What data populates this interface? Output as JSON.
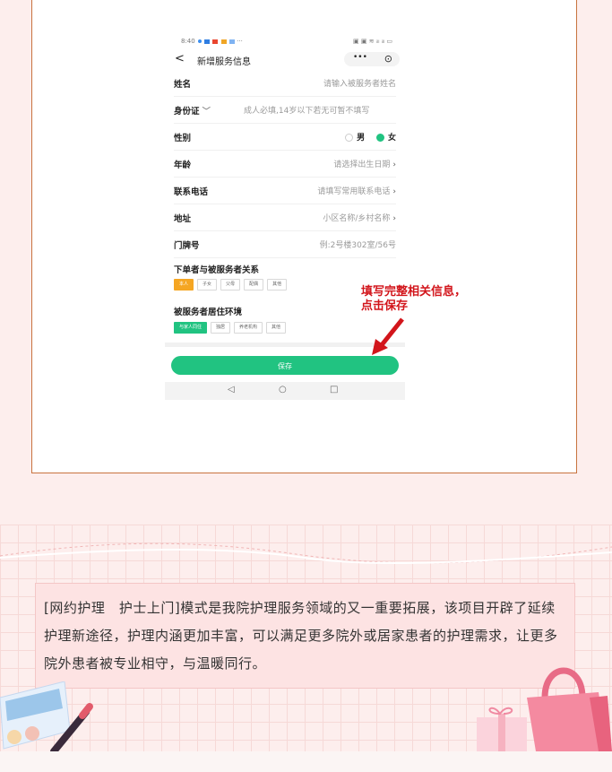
{
  "phone": {
    "status": {
      "time": "8:40",
      "dots": "···"
    },
    "nav": {
      "back": "<",
      "title": "新增服务信息",
      "more": "•••",
      "target": "⊙"
    },
    "form": {
      "name": {
        "label": "姓名",
        "placeholder": "请输入被服务者姓名"
      },
      "id_card": {
        "label": "身份证",
        "placeholder": "成人必填,14岁以下若无可暂不填写"
      },
      "gender": {
        "label": "性别",
        "options": [
          "男",
          "女"
        ],
        "selected": "女"
      },
      "age": {
        "label": "年龄",
        "placeholder": "请选择出生日期"
      },
      "phone": {
        "label": "联系电话",
        "placeholder": "请填写常用联系电话"
      },
      "address": {
        "label": "地址",
        "placeholder": "小区名称/乡村名称"
      },
      "door": {
        "label": "门牌号",
        "placeholder": "例:2号楼302室/56号"
      }
    },
    "relation": {
      "title": "下单者与被服务者关系",
      "tags": [
        "本人",
        "子女",
        "父母",
        "配偶",
        "其他"
      ],
      "selected": "本人"
    },
    "living": {
      "title": "被服务者居住环境",
      "tags": [
        "与家人同住",
        "独居",
        "养老机构",
        "其他"
      ],
      "selected": "与家人同住"
    },
    "save_label": "保存",
    "sysnav": {
      "back": "◁",
      "home": "○",
      "recent": "□"
    }
  },
  "annotation": {
    "line1": "填写完整相关信息，",
    "line2": "点击保存"
  },
  "article": {
    "text": "[网约护理　护士上门]模式是我院护理服务领域的又一重要拓展，该项目开辟了延续护理新途径，护理内涵更加丰富，可以满足更多院外或居家患者的护理需求，让更多院外患者被专业相守，与温暖同行。"
  },
  "colors": {
    "accent_green": "#21c381",
    "accent_orange": "#f5a623",
    "annotation_red": "#d2151b",
    "frame_border": "#c8733f"
  }
}
